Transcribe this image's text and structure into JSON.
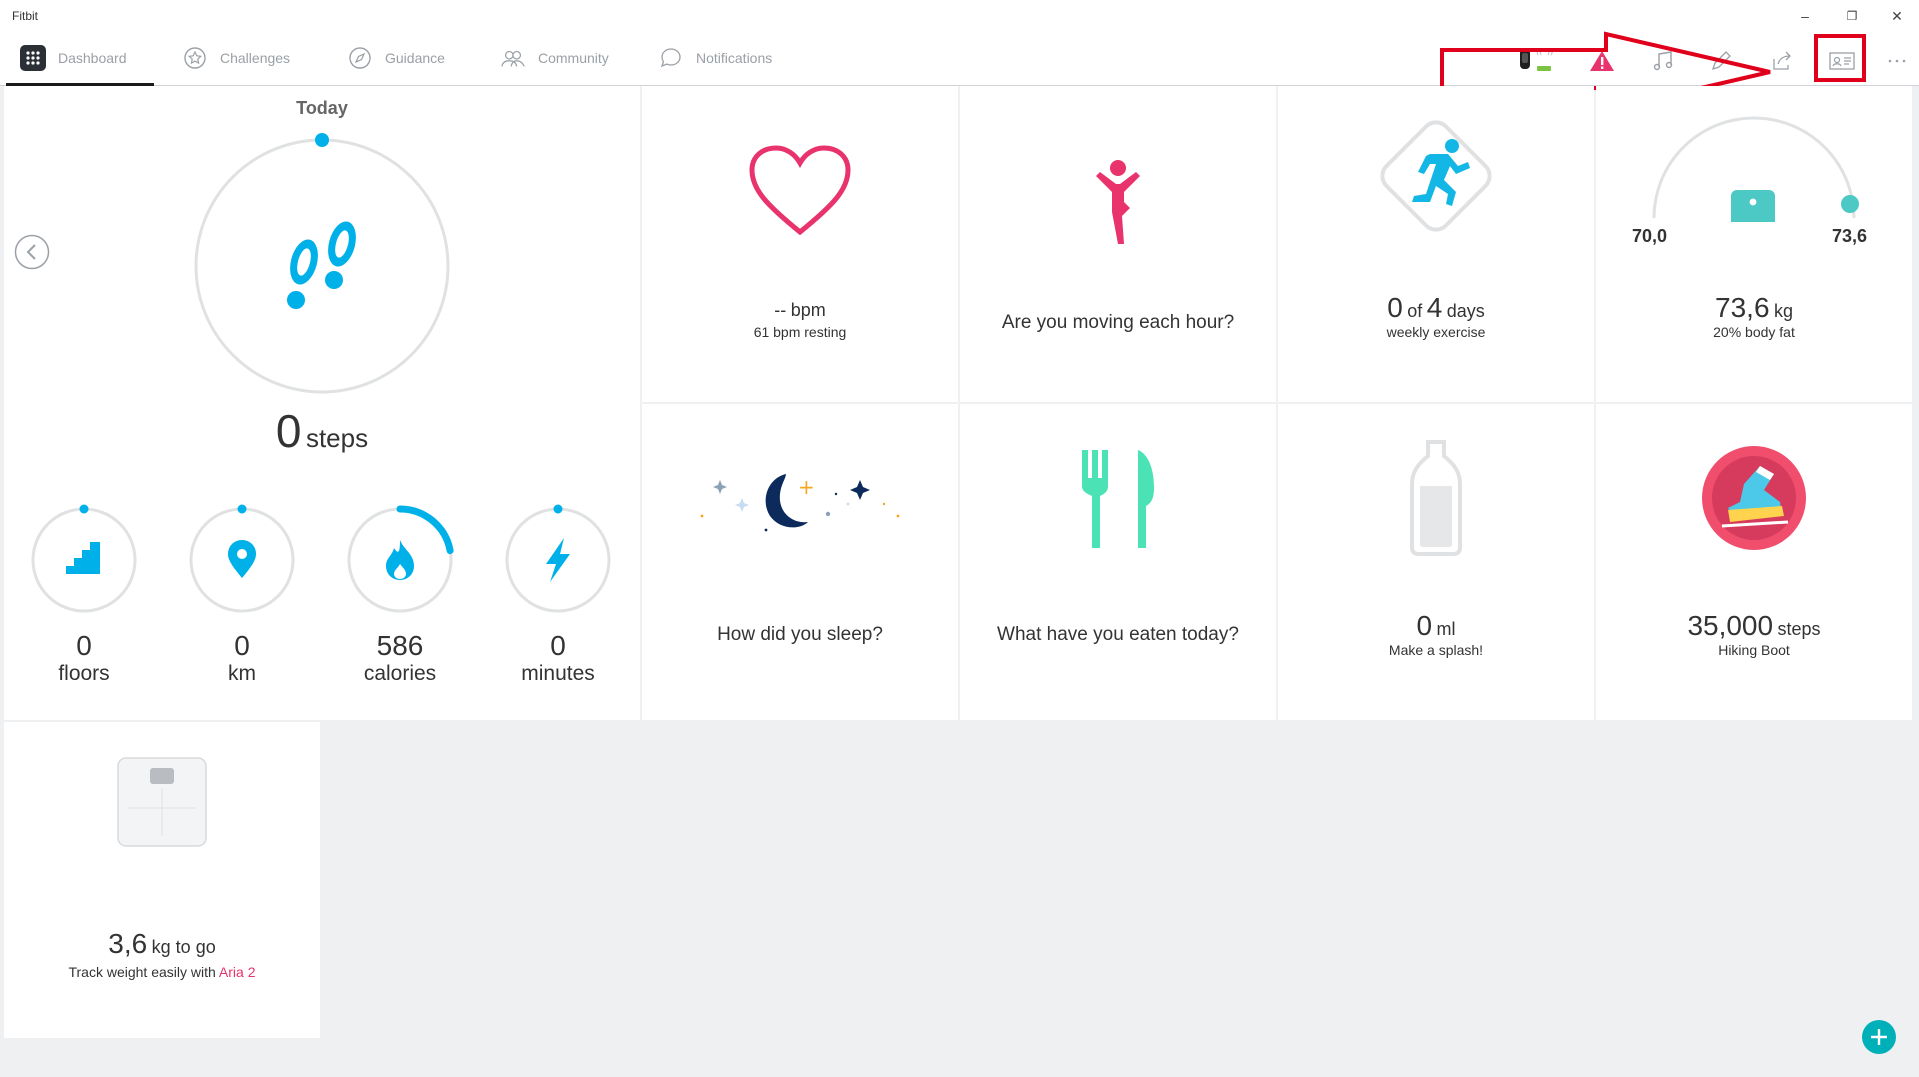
{
  "app": {
    "title": "Fitbit"
  },
  "window_controls": {
    "minimize": "–",
    "restore": "❐",
    "close": "✕"
  },
  "nav": {
    "tabs": [
      {
        "label": "Dashboard",
        "icon": "dashboard-grid-icon"
      },
      {
        "label": "Challenges",
        "icon": "star-badge-icon"
      },
      {
        "label": "Guidance",
        "icon": "compass-icon"
      },
      {
        "label": "Community",
        "icon": "people-icon"
      },
      {
        "label": "Notifications",
        "icon": "chat-bubble-icon"
      }
    ],
    "toolbar_icons": [
      "tracker-sync-icon",
      "alert-icon",
      "music-icon",
      "pen-icon",
      "share-icon",
      "profile-card-icon",
      "more-icon"
    ]
  },
  "steps_card": {
    "period": "Today",
    "steps_value": "0",
    "steps_unit": "steps",
    "stats": [
      {
        "value": "0",
        "label": "floors",
        "icon": "stairs-icon",
        "progress": 0
      },
      {
        "value": "0",
        "label": "km",
        "icon": "location-pin-icon",
        "progress": 0
      },
      {
        "value": "586",
        "label": "calories",
        "icon": "flame-icon",
        "progress": 0.22
      },
      {
        "value": "0",
        "label": "minutes",
        "icon": "lightning-icon",
        "progress": 0
      }
    ]
  },
  "heart_card": {
    "value": "--",
    "unit": "bpm",
    "resting": "61 bpm resting"
  },
  "hourly_card": {
    "question": "Are you moving each hour?"
  },
  "exercise_card": {
    "done": "0",
    "of": "of",
    "goal": "4",
    "unit": "days",
    "label": "weekly exercise"
  },
  "weight_card": {
    "min": "70,0",
    "max": "73,6",
    "value": "73,6",
    "unit": "kg",
    "label": "20% body fat"
  },
  "sleep_card": {
    "question": "How did you sleep?"
  },
  "food_card": {
    "question": "What have you eaten today?"
  },
  "water_card": {
    "value": "0",
    "unit": "ml",
    "label": "Make a splash!"
  },
  "badge_card": {
    "value": "35,000",
    "unit": "steps",
    "label": "Hiking Boot"
  },
  "aria_card": {
    "value": "3,6",
    "unit": "kg to go",
    "label_prefix": "Track weight easily with",
    "label_link": "Aria 2"
  },
  "colors": {
    "accent_teal": "#00b0b9",
    "steps_blue": "#00b0e8",
    "heart_pink": "#e8336d",
    "exercise_blue": "#13b7e6",
    "weight_teal": "#4cc9c4",
    "food_green": "#4be3b5",
    "annotation_red": "#e0001b"
  }
}
